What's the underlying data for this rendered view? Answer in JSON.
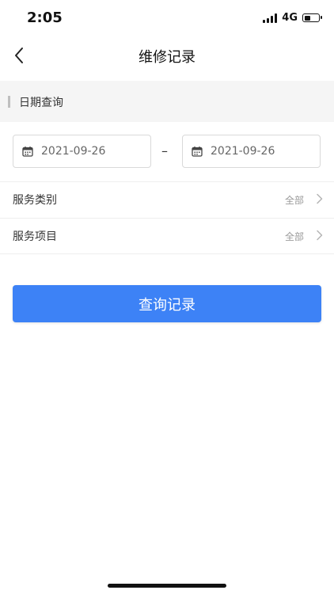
{
  "status_bar": {
    "time": "2:05",
    "network": "4G",
    "battery_level": 0.45
  },
  "nav": {
    "title": "维修记录",
    "back_icon": "chevron-left-icon"
  },
  "section": {
    "title": "日期查询"
  },
  "date_range": {
    "start": "2021-09-26",
    "separator": "–",
    "end": "2021-09-26",
    "icon": "calendar-icon"
  },
  "filters": [
    {
      "label": "服务类别",
      "value": "全部"
    },
    {
      "label": "服务项目",
      "value": "全部"
    }
  ],
  "actions": {
    "query_label": "查询记录"
  },
  "colors": {
    "primary": "#3d82f6",
    "section_bg": "#f5f5f5"
  }
}
